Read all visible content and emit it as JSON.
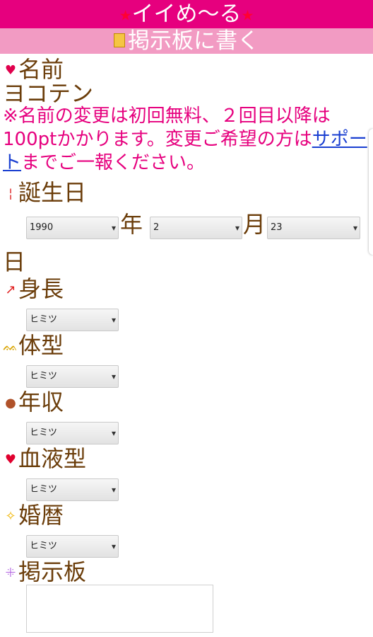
{
  "header": {
    "title": "イイめ〜る",
    "star_left": "★",
    "star_right": "★"
  },
  "subheader": {
    "title": "掲示板に書く"
  },
  "name": {
    "label": "名前",
    "value": "ヨコテン"
  },
  "notice": {
    "text_before": "※名前の変更は初回無料、２回目以降は100ptかかります。変更ご希望の方は",
    "link": "サポート",
    "text_after": "までご一報ください。"
  },
  "birthday": {
    "label": "誕生日",
    "year_value": "1990",
    "year_unit": "年",
    "month_value": "2",
    "month_unit": "月",
    "day_value": "23",
    "day_unit": "日"
  },
  "height": {
    "label": "身長",
    "value": "ヒミツ"
  },
  "body_type": {
    "label": "体型",
    "value": "ヒミツ"
  },
  "income": {
    "label": "年収",
    "value": "ヒミツ"
  },
  "blood_type": {
    "label": "血液型",
    "value": "ヒミツ"
  },
  "marital_history": {
    "label": "婚暦",
    "value": "ヒミツ"
  },
  "board": {
    "label": "掲示板",
    "value": ""
  },
  "colors": {
    "header": "#e6007e",
    "subheader": "#f29bc3",
    "label": "#6b3d0a",
    "notice": "#e6007e",
    "link": "#1a3fd1"
  },
  "icons": [
    "memo-icon",
    "heart-arrow-icon",
    "candles-icon",
    "arrow-up-icon",
    "cat-icon",
    "money-bag-icon",
    "heart-icon",
    "sparkle-icon",
    "ribbon-icon"
  ]
}
